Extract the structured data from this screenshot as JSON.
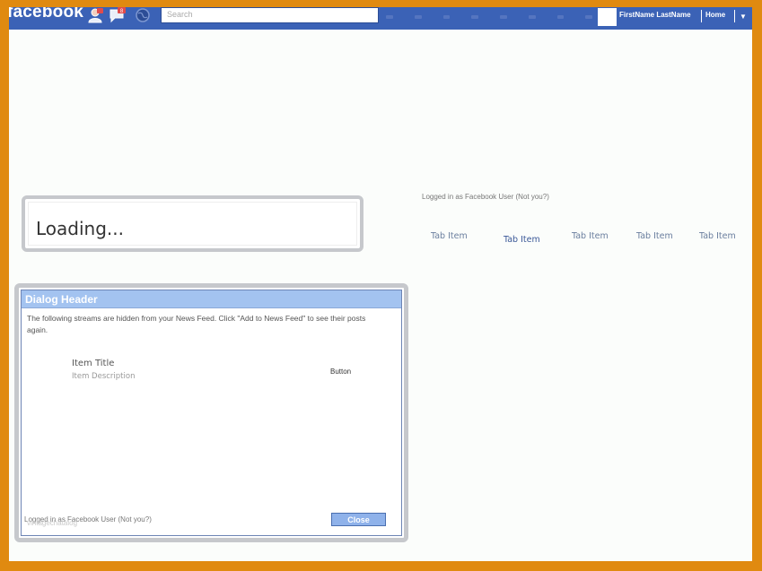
{
  "topbar": {
    "logo": "facebook",
    "search_placeholder": "Search",
    "user_name": "FirstName LastName",
    "home_label": "Home",
    "account_caret": "▼",
    "notification_count": "8"
  },
  "loading": {
    "text": "Loading..."
  },
  "status": {
    "logged_in_text": "Logged in as Facebook User (Not you?)"
  },
  "tabs": [
    "Tab Item",
    "Tab Item",
    "Tab Item",
    "Tab Item",
    "Tab Item"
  ],
  "dialog": {
    "header": "Dialog Header",
    "message": "The following streams are hidden from your News Feed. Click \"Add to News Feed\" to see their posts again.",
    "item": {
      "title": "Item Title",
      "description": "Item Description",
      "button_label": "Button"
    },
    "logged_in_text": "Logged in as Facebook User (Not you?)",
    "close_label": "Close"
  },
  "watermark": "vintagechatalog",
  "colors": {
    "frame": "#e08a10",
    "topbar": "#3b62b6",
    "dialog_header": "#a3c3f0",
    "close_button": "#8fb2ea"
  },
  "icons": [
    "friends-icon",
    "messages-icon",
    "notifications-globe-icon"
  ]
}
